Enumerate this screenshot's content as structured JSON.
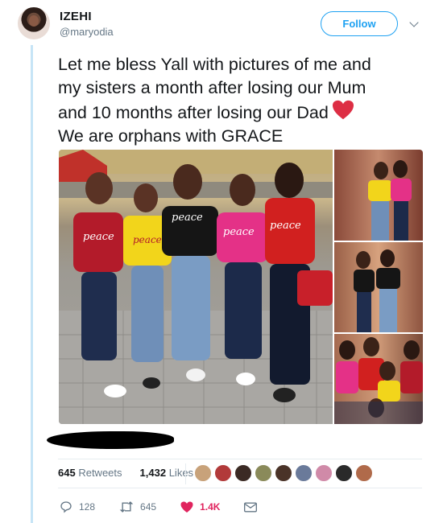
{
  "user": {
    "display_name": "IZEHI",
    "handle": "@maryodia",
    "follow_label": "Follow"
  },
  "tweet": {
    "lines": [
      "Let me bless Yall with pictures of me and",
      "my sisters a month after losing our Mum",
      "and 10 months after losing our Dad",
      "We are orphans with GRACE"
    ],
    "emoji": "red-heart-emoji"
  },
  "media": {
    "main_photo_shirt_text": [
      "peace",
      "peace",
      "peace",
      "peace",
      "peace"
    ]
  },
  "stats": {
    "retweets_count": "645",
    "retweets_label": "Retweets",
    "likes_count": "1,432",
    "likes_label": "Likes"
  },
  "actions": {
    "replies": "128",
    "retweets": "645",
    "likes": "1.4K"
  },
  "icons": {
    "reply": "reply-icon",
    "retweet": "retweet-icon",
    "like": "heart-icon",
    "dm": "envelope-icon"
  },
  "colors": {
    "accent": "#1da1f2",
    "like": "#e0245e",
    "thread_line": "#c6e4f6"
  }
}
